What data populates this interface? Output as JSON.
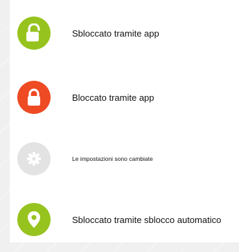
{
  "events": [
    {
      "label": "Sbloccato tramite app",
      "icon": "unlock-icon",
      "color": "#97c31e"
    },
    {
      "label": "Bloccato tramite app",
      "icon": "lock-icon",
      "color": "#ee4a24"
    },
    {
      "label": "Le impostazioni sono cambiate",
      "icon": "gear-icon",
      "color": "#e3e3e3"
    },
    {
      "label": "Sbloccato tramite sblocco automatico",
      "icon": "location-pin-icon",
      "color": "#97c31e"
    }
  ]
}
